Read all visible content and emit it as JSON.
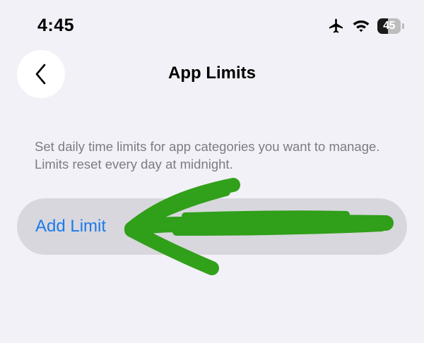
{
  "status_bar": {
    "time": "4:45",
    "battery_level": "45",
    "battery_fraction": 0.45,
    "icons": [
      "airplane-icon",
      "wifi-icon",
      "battery-icon"
    ]
  },
  "nav": {
    "back_icon": "chevron-left-icon",
    "title": "App Limits"
  },
  "description": "Set daily time limits for app categories you want to manage. Limits reset every day at midnight.",
  "add_limit": {
    "label": "Add Limit"
  },
  "annotation": {
    "arrow_icon": "arrow-left-icon",
    "arrow_color": "#2a9d12"
  },
  "colors": {
    "background": "#f2f1f7",
    "accent": "#1a7bea",
    "row_background": "#d8d7dd",
    "secondary_text": "#7d7c82"
  }
}
